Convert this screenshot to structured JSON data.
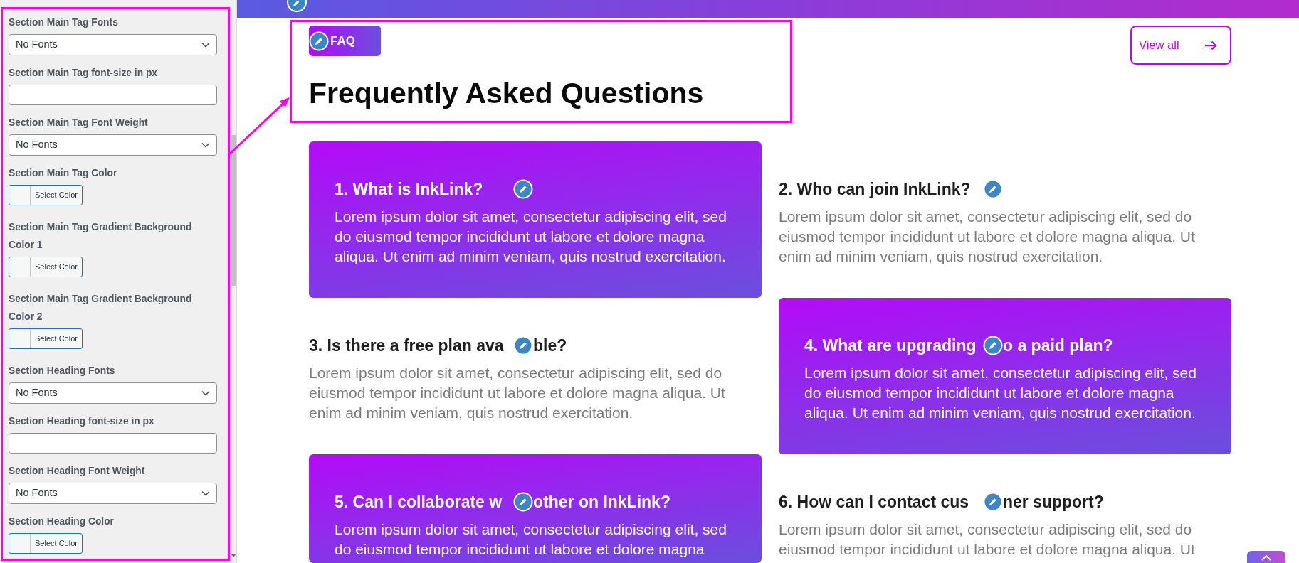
{
  "settings_panel": {
    "fields": [
      {
        "kind": "select",
        "label": "Section Main Tag Fonts",
        "value": "No Fonts"
      },
      {
        "kind": "text",
        "label": "Section Main Tag font-size in px"
      },
      {
        "kind": "select",
        "label": "Section Main Tag Font Weight",
        "value": "No Fonts"
      },
      {
        "kind": "color",
        "label": "Section Main Tag Color",
        "button": "Select Color"
      },
      {
        "kind": "color",
        "label": "Section Main Tag Gradient Background Color 1",
        "button": "Select Color"
      },
      {
        "kind": "color",
        "label": "Section Main Tag Gradient Background Color 2",
        "button": "Select Color"
      },
      {
        "kind": "select",
        "label": "Section Heading Fonts",
        "value": "No Fonts"
      },
      {
        "kind": "text",
        "label": "Section Heading font-size in px"
      },
      {
        "kind": "select",
        "label": "Section Heading Font Weight",
        "value": "No Fonts"
      },
      {
        "kind": "color",
        "label": "Section Heading Color",
        "button": "Select Color"
      }
    ]
  },
  "section": {
    "tag": "FAQ",
    "heading": "Frequently Asked Questions",
    "view_all": "View all",
    "items": [
      {
        "highlighted": true,
        "title_parts": [
          "1. What is InkLink?"
        ],
        "body": "Lorem ipsum dolor sit amet, consectetur adipiscing elit, sed do eiusmod tempor incididunt ut labore et dolore magna aliqua. Ut enim ad minim veniam, quis nostrud exercitation."
      },
      {
        "highlighted": false,
        "title_parts": [
          "2. Who can join InkLink?"
        ],
        "body": "Lorem ipsum dolor sit amet, consectetur adipiscing elit, sed do eiusmod tempor incididunt ut labore et dolore magna aliqua. Ut enim ad minim veniam, quis nostrud exercitation."
      },
      {
        "highlighted": false,
        "title_parts": [
          "3. Is there a free plan ava",
          "ble?"
        ],
        "body": "Lorem ipsum dolor sit amet, consectetur adipiscing elit, sed do eiusmod tempor incididunt ut labore et dolore magna aliqua. Ut enim ad minim veniam, quis nostrud exercitation."
      },
      {
        "highlighted": true,
        "title_parts": [
          "4. What are upgrading",
          "o a paid plan?"
        ],
        "body": "Lorem ipsum dolor sit amet, consectetur adipiscing elit, sed do eiusmod tempor incididunt ut labore et dolore magna aliqua. Ut enim ad minim veniam, quis nostrud exercitation."
      },
      {
        "highlighted": true,
        "title_parts": [
          "5. Can I collaborate w",
          "other on InkLink?"
        ],
        "body": "Lorem ipsum dolor sit amet, consectetur adipiscing elit, sed do eiusmod tempor incididunt ut labore et dolore magna"
      },
      {
        "highlighted": false,
        "title_parts": [
          "6. How can I contact cus",
          "ner support?"
        ],
        "body": "Lorem ipsum dolor sit amet, consectetur adipiscing elit, sed do eiusmod tempor incididunt ut labore et dolore magna aliqua. Ut"
      }
    ]
  }
}
